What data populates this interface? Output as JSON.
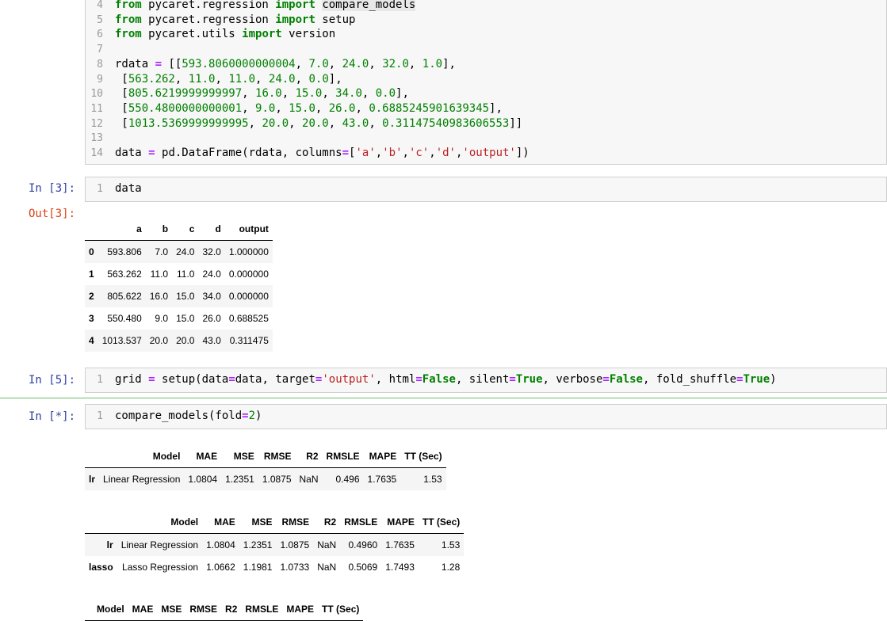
{
  "cell1": {
    "lines": [
      {
        "n": "4",
        "html": "<span class='kw'>from</span> pycaret.regression <span class='kw'>import</span> <span class='hl'>compare_models</span>"
      },
      {
        "n": "5",
        "html": "<span class='kw'>from</span> pycaret.regression <span class='kw'>import</span> setup"
      },
      {
        "n": "6",
        "html": "<span class='kw'>from</span> pycaret.utils <span class='kw'>import</span> version"
      },
      {
        "n": "7",
        "html": ""
      },
      {
        "n": "8",
        "html": "rdata <span class='op'>=</span> [[<span class='num'>593.8060000000004</span>, <span class='num'>7.0</span>, <span class='num'>24.0</span>, <span class='num'>32.0</span>, <span class='num'>1.0</span>],"
      },
      {
        "n": "9",
        "html": " [<span class='num'>563.262</span>, <span class='num'>11.0</span>, <span class='num'>11.0</span>, <span class='num'>24.0</span>, <span class='num'>0.0</span>],"
      },
      {
        "n": "10",
        "html": " [<span class='num'>805.6219999999997</span>, <span class='num'>16.0</span>, <span class='num'>15.0</span>, <span class='num'>34.0</span>, <span class='num'>0.0</span>],"
      },
      {
        "n": "11",
        "html": " [<span class='num'>550.4800000000001</span>, <span class='num'>9.0</span>, <span class='num'>15.0</span>, <span class='num'>26.0</span>, <span class='num'>0.6885245901639345</span>],"
      },
      {
        "n": "12",
        "html": " [<span class='num'>1013.5369999999995</span>, <span class='num'>20.0</span>, <span class='num'>20.0</span>, <span class='num'>43.0</span>, <span class='num'>0.31147540983606553</span>]]"
      },
      {
        "n": "13",
        "html": ""
      },
      {
        "n": "14",
        "html": "data <span class='op'>=</span> pd.DataFrame(rdata, columns<span class='op'>=</span>[<span class='str'>'a'</span>,<span class='str'>'b'</span>,<span class='str'>'c'</span>,<span class='str'>'d'</span>,<span class='str'>'output'</span>])"
      }
    ]
  },
  "cell3": {
    "prompt_in": "In [3]:",
    "prompt_out": "Out[3]:",
    "line_no": "1",
    "code": "data",
    "table": {
      "headers": [
        "",
        "a",
        "b",
        "c",
        "d",
        "output"
      ],
      "rows": [
        [
          "0",
          "593.806",
          "7.0",
          "24.0",
          "32.0",
          "1.000000"
        ],
        [
          "1",
          "563.262",
          "11.0",
          "11.0",
          "24.0",
          "0.000000"
        ],
        [
          "2",
          "805.622",
          "16.0",
          "15.0",
          "34.0",
          "0.000000"
        ],
        [
          "3",
          "550.480",
          "9.0",
          "15.0",
          "26.0",
          "0.688525"
        ],
        [
          "4",
          "1013.537",
          "20.0",
          "20.0",
          "43.0",
          "0.311475"
        ]
      ]
    }
  },
  "cell5": {
    "prompt_in": "In [5]:",
    "line_no": "1",
    "code_html": "grid <span class='op'>=</span> setup(data<span class='op'>=</span>data, target<span class='op'>=</span><span class='str'>'output'</span>, html<span class='op'>=</span><span class='kw'>False</span>, silent<span class='op'>=</span><span class='kw'>True</span>, verbose<span class='op'>=</span><span class='kw'>False</span>, fold_shuffle<span class='op'>=</span><span class='kw'>True</span>)"
  },
  "cell6": {
    "prompt_in": "In [*]:",
    "line_no": "1",
    "code_html": "compare_models(fold<span class='op'>=</span><span class='num'>2</span>)",
    "table1": {
      "headers": [
        "",
        "Model",
        "MAE",
        "MSE",
        "RMSE",
        "R2",
        "RMSLE",
        "MAPE",
        "TT (Sec)"
      ],
      "rows": [
        [
          "lr",
          "Linear Regression",
          "1.0804",
          "1.2351",
          "1.0875",
          "NaN",
          "0.496",
          "1.7635",
          "1.53"
        ]
      ]
    },
    "table2": {
      "headers": [
        "",
        "Model",
        "MAE",
        "MSE",
        "RMSE",
        "R2",
        "RMSLE",
        "MAPE",
        "TT (Sec)"
      ],
      "rows": [
        [
          "lr",
          "Linear Regression",
          "1.0804",
          "1.2351",
          "1.0875",
          "NaN",
          "0.4960",
          "1.7635",
          "1.53"
        ],
        [
          "lasso",
          "Lasso Regression",
          "1.0662",
          "1.1981",
          "1.0733",
          "NaN",
          "0.5069",
          "1.7493",
          "1.28"
        ]
      ]
    },
    "table3": {
      "headers": [
        "",
        "Model",
        "MAE",
        "MSE",
        "RMSE",
        "R2",
        "RMSLE",
        "MAPE",
        "TT (Sec)"
      ],
      "rows": []
    }
  }
}
